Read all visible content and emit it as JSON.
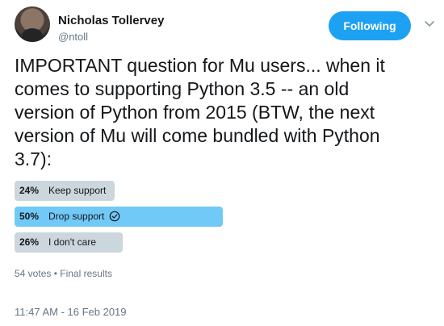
{
  "author": {
    "display_name": "Nicholas Tollervey",
    "handle": "@ntoll"
  },
  "follow_button": {
    "label": "Following"
  },
  "tweet": {
    "text": "IMPORTANT question for Mu users... when it\ncomes to supporting Python 3.5 -- an old\nversion of Python from 2015 (BTW, the next\nversion of Mu will come bundled with Python\n3.7):"
  },
  "poll": {
    "options": [
      {
        "percent_label": "24%",
        "percent": 24,
        "label": "Keep support",
        "winner": false
      },
      {
        "percent_label": "50%",
        "percent": 50,
        "label": "Drop support",
        "winner": true
      },
      {
        "percent_label": "26%",
        "percent": 26,
        "label": "I don't care",
        "winner": false
      }
    ],
    "votes": "54 votes",
    "separator": "•",
    "status": "Final results"
  },
  "timestamp": "11:47 AM - 16 Feb 2019",
  "colors": {
    "accent": "#1da1f2",
    "winner_bar": "#71c9f8",
    "loser_bar": "#ccd6dd",
    "muted_text": "#657786"
  },
  "icons": {
    "chevron": "chevron-down-icon",
    "winner": "check-circle-icon",
    "avatar": "profile-photo"
  }
}
